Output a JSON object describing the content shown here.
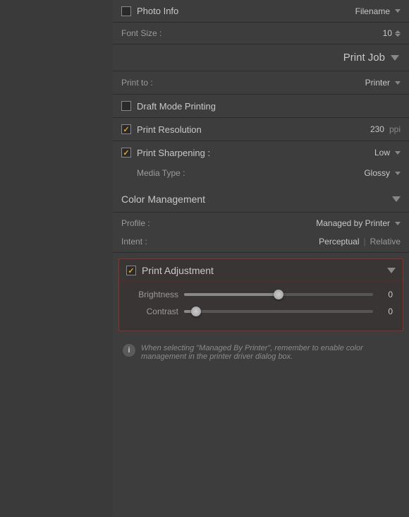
{
  "sidebar": {
    "background": "#3a3a3a"
  },
  "photo_info": {
    "label": "Photo Info",
    "value": "Filename",
    "checkbox_checked": false
  },
  "font_size": {
    "label": "Font Size :",
    "value": "10"
  },
  "print_job": {
    "title": "Print Job"
  },
  "print_to": {
    "label": "Print to :",
    "value": "Printer"
  },
  "draft_mode": {
    "label": "Draft Mode Printing",
    "checked": false
  },
  "print_resolution": {
    "label": "Print Resolution",
    "value": "230",
    "unit": "ppi",
    "checked": true
  },
  "print_sharpening": {
    "label": "Print Sharpening :",
    "value": "Low",
    "checked": true
  },
  "media_type": {
    "label": "Media Type :",
    "value": "Glossy"
  },
  "color_management": {
    "title": "Color Management"
  },
  "profile": {
    "label": "Profile :",
    "value": "Managed by Printer"
  },
  "intent": {
    "label": "Intent :",
    "option1": "Perceptual",
    "separator": "|",
    "option2": "Relative"
  },
  "print_adjustment": {
    "title": "Print Adjustment",
    "checked": true
  },
  "brightness": {
    "label": "Brightness",
    "value": "0",
    "percent": 50
  },
  "contrast": {
    "label": "Contrast",
    "value": "0",
    "percent": 5
  },
  "info_note": {
    "text": "When selecting \"Managed By Printer\", remember to enable color management in the printer driver dialog box."
  }
}
